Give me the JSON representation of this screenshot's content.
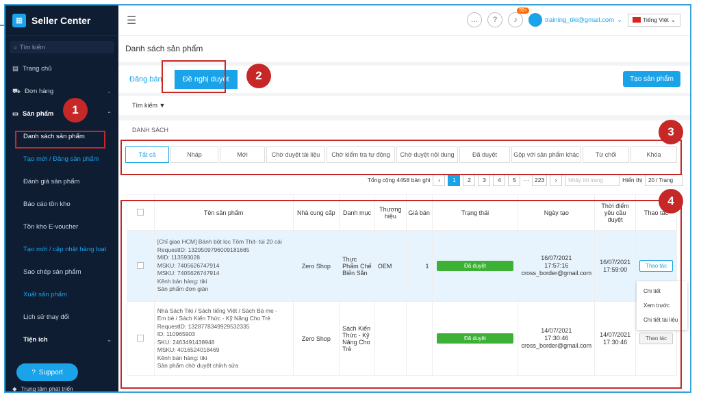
{
  "app": {
    "title": "Seller Center"
  },
  "sidebar": {
    "search_placeholder": "Tìm kiếm",
    "items": [
      {
        "label": "Trang chủ",
        "icon": "chart-icon"
      },
      {
        "label": "Đơn hàng",
        "icon": "cart-icon"
      },
      {
        "label": "Sản phẩm",
        "icon": "box-icon"
      }
    ],
    "sub_items": [
      {
        "label": "Danh sách sản phẩm"
      },
      {
        "label": "Tạo mới / Đăng sản phẩm"
      },
      {
        "label": "Đánh giá sản phẩm"
      },
      {
        "label": "Báo cáo tồn kho"
      },
      {
        "label": "Tồn kho E-voucher"
      },
      {
        "label": "Tạo mới / cập nhật hàng loạt"
      },
      {
        "label": "Sao chép sản phẩm"
      },
      {
        "label": "Xuất sản phẩm"
      },
      {
        "label": "Lịch sử thay đổi"
      }
    ],
    "utilities": "Tiện ích",
    "dev_center": "Trung tâm phát triển",
    "support": "Support"
  },
  "topbar": {
    "notif_count": "99+",
    "user_email": "training_tiki@gmail.com",
    "language": "Tiếng Việt"
  },
  "page": {
    "title": "Danh sách sản phẩm"
  },
  "status_tabs": [
    {
      "label": "Đăng bán"
    },
    {
      "label": "Đề nghị duyệt"
    }
  ],
  "create_button": "Tạo sản phẩm",
  "filter_label": "Tìm kiếm",
  "list_label": "DANH SÁCH",
  "filter_tabs": [
    "Tất cả",
    "Nháp",
    "Mới",
    "Chờ duyệt tài liệu",
    "Chờ kiểm tra tự động",
    "Chờ duyệt nội dung",
    "Đã duyệt",
    "Gộp với sản phẩm khác",
    "Từ chối",
    "Khóa"
  ],
  "pagination": {
    "total": "Tổng cộng 4458 bản ghi",
    "pages": [
      "1",
      "2",
      "3",
      "4",
      "5",
      "···",
      "223"
    ],
    "jump_placeholder": "Nhảy tới trang",
    "show_label": "Hiển thị",
    "per_page": "20 / Trang"
  },
  "table": {
    "headers": [
      "Tên sản phẩm",
      "Nhà cung cấp",
      "Danh mục",
      "Thương hiệu",
      "Giá bán",
      "Trạng thái",
      "Ngày tạo",
      "Thời điểm yêu cầu duyệt",
      "Thao tác"
    ],
    "rows": [
      {
        "name_lines": [
          "[Chỉ giao HCM] Bánh bột lọc Tôm Thịt- túi 20 cái",
          "RequestID: 1329509796009181685",
          "MID: 113593028",
          "MSKU: 7405626747914",
          "MSKU: 7405626747914",
          "Kênh bán hàng: tiki",
          "Sản phẩm đơn giản"
        ],
        "supplier": "Zero Shop",
        "category": "Thực Phẩm Chế Biến Sẵn",
        "brand": "OEM",
        "price": "1",
        "status": "Đã duyệt",
        "created_date": "16/07/2021",
        "created_time": "17:57:16",
        "created_by": "cross_border@gmail.com",
        "req_date": "16/07/2021",
        "req_time": "17:59:00",
        "action": "Thao tác"
      },
      {
        "name_lines": [
          "Nhà Sách Tiki / Sách tiếng Việt / Sách Bà mẹ -",
          "Em bé / Sách Kiến Thức - Kỹ Năng Cho Trẻ",
          "RequestID: 1328778349929532335",
          "ID: 110965903",
          "SKU: 2463491438948",
          "MSKU: 4016524018469",
          "Kênh bán hàng: tiki",
          "Sản phẩm chờ duyệt chỉnh sửa"
        ],
        "supplier": "Zero Shop",
        "category": "Sách Kiến Thức - Kỹ Năng Cho Trẻ",
        "brand": "",
        "price": "",
        "status": "Đã duyệt",
        "created_date": "14/07/2021",
        "created_time": "17:30:46",
        "created_by": "cross_border@gmail.com",
        "req_date": "14/07/2021",
        "req_time": "17:30:46",
        "action": "Thao tác"
      }
    ]
  },
  "action_menu": [
    "Chi tiết",
    "Xem trước",
    "Chi tiết tài liệu"
  ],
  "annotations": [
    "1",
    "2",
    "3",
    "4"
  ]
}
